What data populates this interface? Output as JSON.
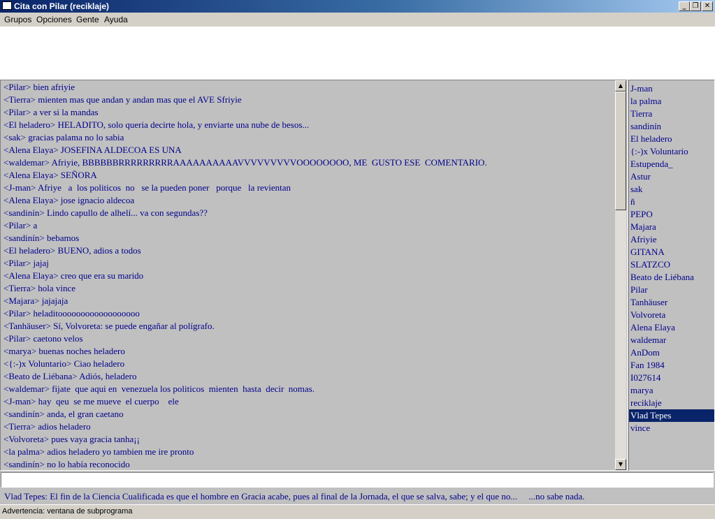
{
  "window": {
    "title": "Cita con Pilar (reciklaje)",
    "minimize_glyph": "_",
    "restore_glyph": "❐",
    "close_glyph": "✕"
  },
  "menu": [
    "Grupos",
    "Opciones",
    "Gente",
    "Ayuda"
  ],
  "chat": {
    "lines": [
      "<Pilar> bien afriyie",
      "<Tierra> mienten mas que andan y andan mas que el AVE Sfriyie",
      "<Pilar> a ver si la mandas",
      "<El heladero> HELADITO, solo queria decirte hola, y enviarte una nube de besos...",
      "<sak> gracias palama no lo sabia",
      "<Alena Elaya> JOSEFINA ALDECOA ES UNA",
      "<waldemar> Afriyie, BBBBBBRRRRRRRRRAAAAAAAAAAVVVVVVVVVOOOOOOOO, ME  GUSTO ESE  COMENTARIO.",
      "<Alena Elaya> SEÑORA",
      "<J-man> Afriye   a  los politicos  no   se la pueden poner   porque   la revientan",
      "<Alena Elaya> jose ignacio aldecoa",
      "<sandinín> Lindo capullo de alhelí... va con segundas??",
      "<Pilar> a",
      "<sandinín> bebamos",
      "<El heladero> BUENO, adios a todos",
      "<Pilar> jajaj",
      "<Alena Elaya> creo que era su marido",
      "<Tierra> hola vince",
      "<Majara> jajajaja",
      "<Pilar> heladitoooooooooooooooooo",
      "<Tanhäuser> Sí, Volvoreta: se puede engañar al polígrafo.",
      "<Pilar> caetono velos",
      "<marya> buenas noches heladero",
      "<{:-)x Voluntario> Ciao heladero",
      "<Beato de Liébana> Adiós, heladero",
      "<waldemar> fijate  que aqui en  venezuela los politicos  mienten  hasta  decir  nomas.",
      "<J-man> hay  qeu  se me mueve  el cuerpo    ele",
      "<sandinín> anda, el gran caetano",
      "<Tierra> adios heladero",
      "<Volvoreta> pues vaya gracia tanha¡¡",
      "<la palma> adios heladero yo tambien me ire pronto",
      "<sandinín> no lo había reconocido"
    ]
  },
  "scrollbar": {
    "up_glyph": "▲",
    "down_glyph": "▼"
  },
  "users": {
    "items": [
      "J-man",
      "la palma",
      "Tierra",
      "sandinín",
      "El heladero",
      "{:-)x Voluntario",
      "Estupenda_",
      "Astur",
      "sak",
      "ñ",
      "PEPO",
      "Majara",
      "Afriyie",
      "GITANA",
      "SLATZCO",
      "Beato de Liébana",
      "Pilar",
      "Tanhäuser",
      "Volvoreta",
      "Alena Elaya",
      "waldemar",
      "AnDom",
      "Fan 1984",
      "I027614",
      "marya",
      "reciklaje",
      "Vlad Tepes",
      "vince"
    ],
    "selected": "Vlad Tepes"
  },
  "input": {
    "value": ""
  },
  "quote": "Vlad Tepes: El fin de la Ciencia Cualificada es que el hombre en Gracia acabe, pues al final de la Jornada, el que se salva, sabe; y el que no...     ...no sabe nada.",
  "status": "Advertencia: ventana de subprograma",
  "colors": {
    "chat_text": "#00008b",
    "selection": "#0a246a"
  }
}
